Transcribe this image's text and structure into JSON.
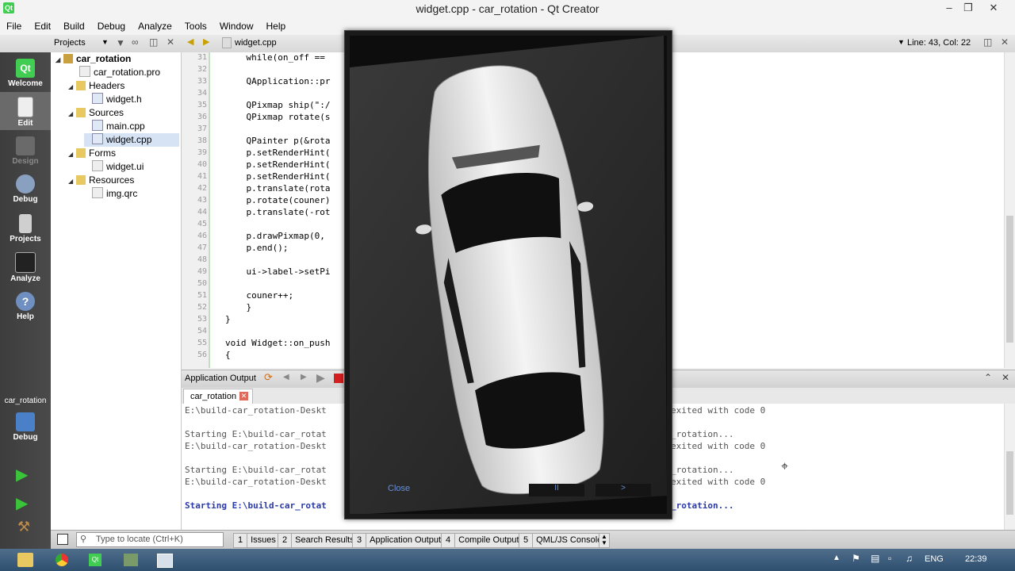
{
  "window": {
    "title": "widget.cpp - car_rotation - Qt Creator"
  },
  "menu": [
    "File",
    "Edit",
    "Build",
    "Debug",
    "Analyze",
    "Tools",
    "Window",
    "Help"
  ],
  "toolbar": {
    "projects_label": "Projects",
    "file_tab": "widget.cpp",
    "position": "Line: 43, Col: 22"
  },
  "modes": [
    "Welcome",
    "Edit",
    "Design",
    "Debug",
    "Projects",
    "Analyze",
    "Help"
  ],
  "target": {
    "name": "car_rotation",
    "mode": "Debug"
  },
  "tree": [
    {
      "label": "car_rotation",
      "bold": true
    },
    {
      "label": "car_rotation.pro"
    },
    {
      "label": "Headers"
    },
    {
      "label": "widget.h"
    },
    {
      "label": "Sources"
    },
    {
      "label": "main.cpp"
    },
    {
      "label": "widget.cpp"
    },
    {
      "label": "Forms"
    },
    {
      "label": "widget.ui"
    },
    {
      "label": "Resources"
    },
    {
      "label": "img.qrc"
    }
  ],
  "editor": {
    "line_numbers": [
      "31",
      "32",
      "33",
      "34",
      "35",
      "36",
      "37",
      "38",
      "39",
      "40",
      "41",
      "42",
      "43",
      "44",
      "45",
      "46",
      "47",
      "48",
      "49",
      "50",
      "51",
      "52",
      "53",
      "54",
      "55",
      "56"
    ],
    "lines": [
      "    while(on_off ==",
      "",
      "    QApplication::pr",
      "",
      "    QPixmap ship(\":/",
      "    QPixmap rotate(s",
      "",
      "    QPainter p(&rota",
      "    p.setRenderHint(",
      "    p.setRenderHint(",
      "    p.setRenderHint(",
      "    p.translate(rota",
      "    p.rotate(couner)",
      "    p.translate(-rot",
      "",
      "    p.drawPixmap(0,",
      "    p.end();",
      "",
      "    ui->label->setPi",
      "",
      "    couner++;",
      "    }",
      "}",
      "",
      "void Widget::on_push",
      "{"
    ]
  },
  "output": {
    "title": "Application Output",
    "tab": "car_rotation",
    "lines": [
      {
        "text": "E:\\build-car_rotation-Deskt",
        "tail": "exited with code 0"
      },
      {
        "text": "",
        "tail": ""
      },
      {
        "text": "Starting E:\\build-car_rotat",
        "tail": "_rotation..."
      },
      {
        "text": "E:\\build-car_rotation-Deskt",
        "tail": "exited with code 0"
      },
      {
        "text": "",
        "tail": ""
      },
      {
        "text": "Starting E:\\build-car_rotat",
        "tail": "_rotation..."
      },
      {
        "text": "E:\\build-car_rotation-Deskt",
        "tail": "exited with code 0"
      },
      {
        "text": "",
        "tail": ""
      },
      {
        "text": "Starting E:\\build-car_rotat",
        "tail": "_rotation...",
        "blue": true
      }
    ]
  },
  "dialog": {
    "close_label": "Close",
    "pause_label": "II",
    "next_label": ">"
  },
  "statusbar": {
    "locator_placeholder": "Type to locate (Ctrl+K)",
    "tabs": [
      {
        "num": "1",
        "label": "Issues"
      },
      {
        "num": "2",
        "label": "Search Results"
      },
      {
        "num": "3",
        "label": "Application Output"
      },
      {
        "num": "4",
        "label": "Compile Output"
      },
      {
        "num": "5",
        "label": "QML/JS Console"
      }
    ]
  },
  "taskbar": {
    "lang": "ENG",
    "time": "22:39"
  }
}
